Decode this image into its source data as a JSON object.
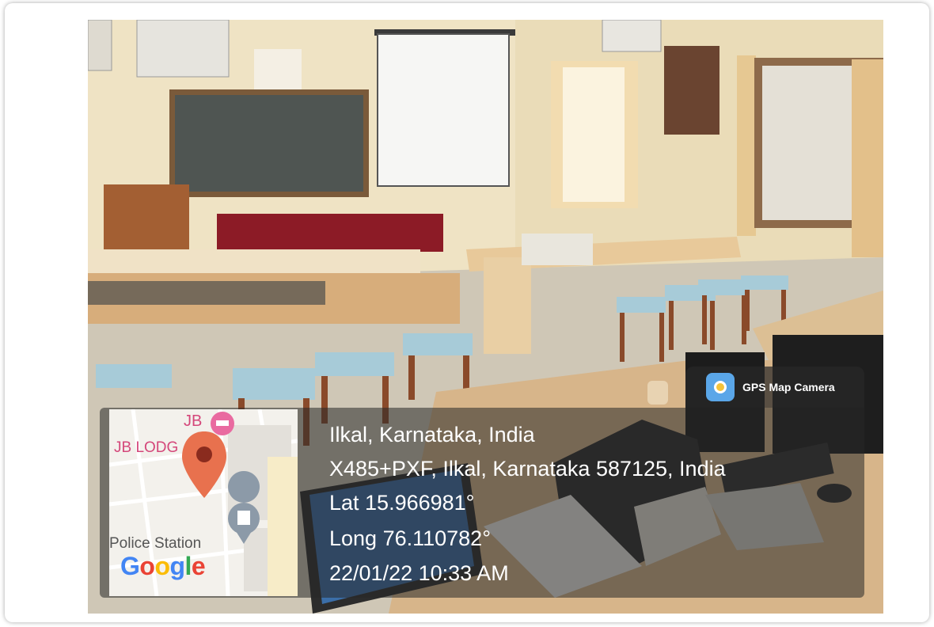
{
  "overlay": {
    "app_name": "GPS Map Camera",
    "location_title": "Ilkal, Karnataka, India",
    "address": "X485+PXF, Ilkal, Karnataka 587125, India",
    "latitude": "Lat 15.966981°",
    "longitude": "Long 76.110782°",
    "datetime": "22/01/22 10:33 AM"
  },
  "map": {
    "label_jb": "JB",
    "label_lodge": "JB LODG",
    "label_police": "Police Station",
    "logo": "Google",
    "marker_icon": "map-pin-icon",
    "hotel_icon": "hotel-icon",
    "police_icon": "police-icon"
  },
  "colors": {
    "overlay_bg": "#282828",
    "marker": "#e8714e",
    "gps_icon_bg": "#5aa6e8"
  }
}
